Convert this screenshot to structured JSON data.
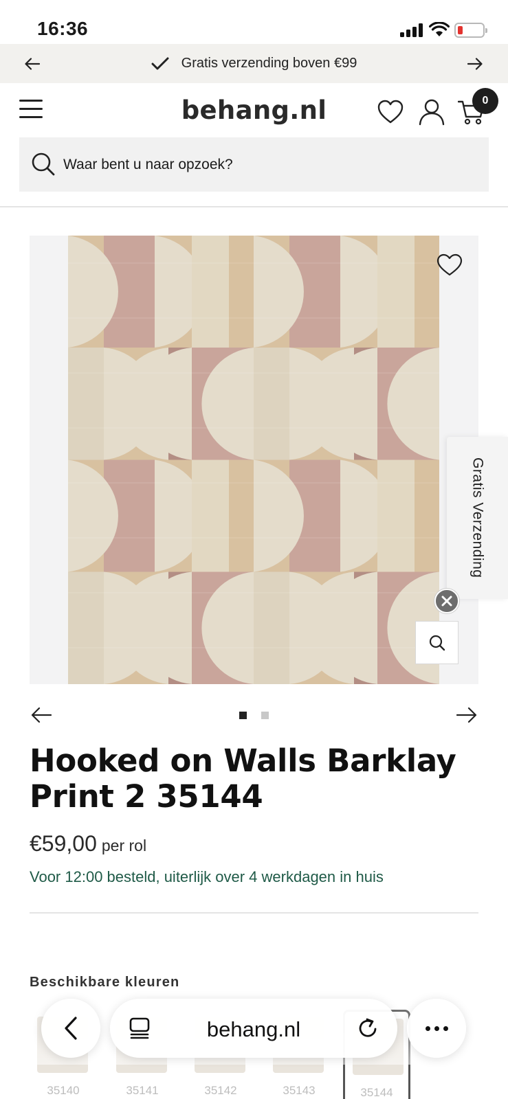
{
  "status_bar": {
    "time": "16:36"
  },
  "promo_bar": {
    "text": "Gratis verzending boven €99"
  },
  "header": {
    "logo": "behang.nl",
    "cart_count": "0"
  },
  "search": {
    "placeholder": "Waar bent u naar opzoek?",
    "value": ""
  },
  "gallery": {
    "side_tab_label": "Gratis Verzending",
    "active_slide": 1,
    "total_slides": 2,
    "wallpaper_colors": {
      "pink": "#c9a59b",
      "beige": "#d8c1a0",
      "cream": "#e4dccb",
      "mauve": "#b38e84"
    }
  },
  "product": {
    "title": "Hooked on Walls Barklay Print 2 35144",
    "price": "€59,00",
    "price_unit": "per rol",
    "delivery": "Voor 12:00 besteld, uiterlijk over 4 werkdagen in huis"
  },
  "colors": {
    "heading": "Beschikbare kleuren",
    "swatches": [
      {
        "code": "35140"
      },
      {
        "code": "35141"
      },
      {
        "code": "35142"
      },
      {
        "code": "35143"
      },
      {
        "code": "35144"
      }
    ]
  },
  "browser": {
    "url": "behang.nl"
  },
  "theme": {
    "delivery_green": "#1f5a47",
    "promo_bg": "#f2f1ee",
    "search_bg": "#f1f1f1"
  }
}
